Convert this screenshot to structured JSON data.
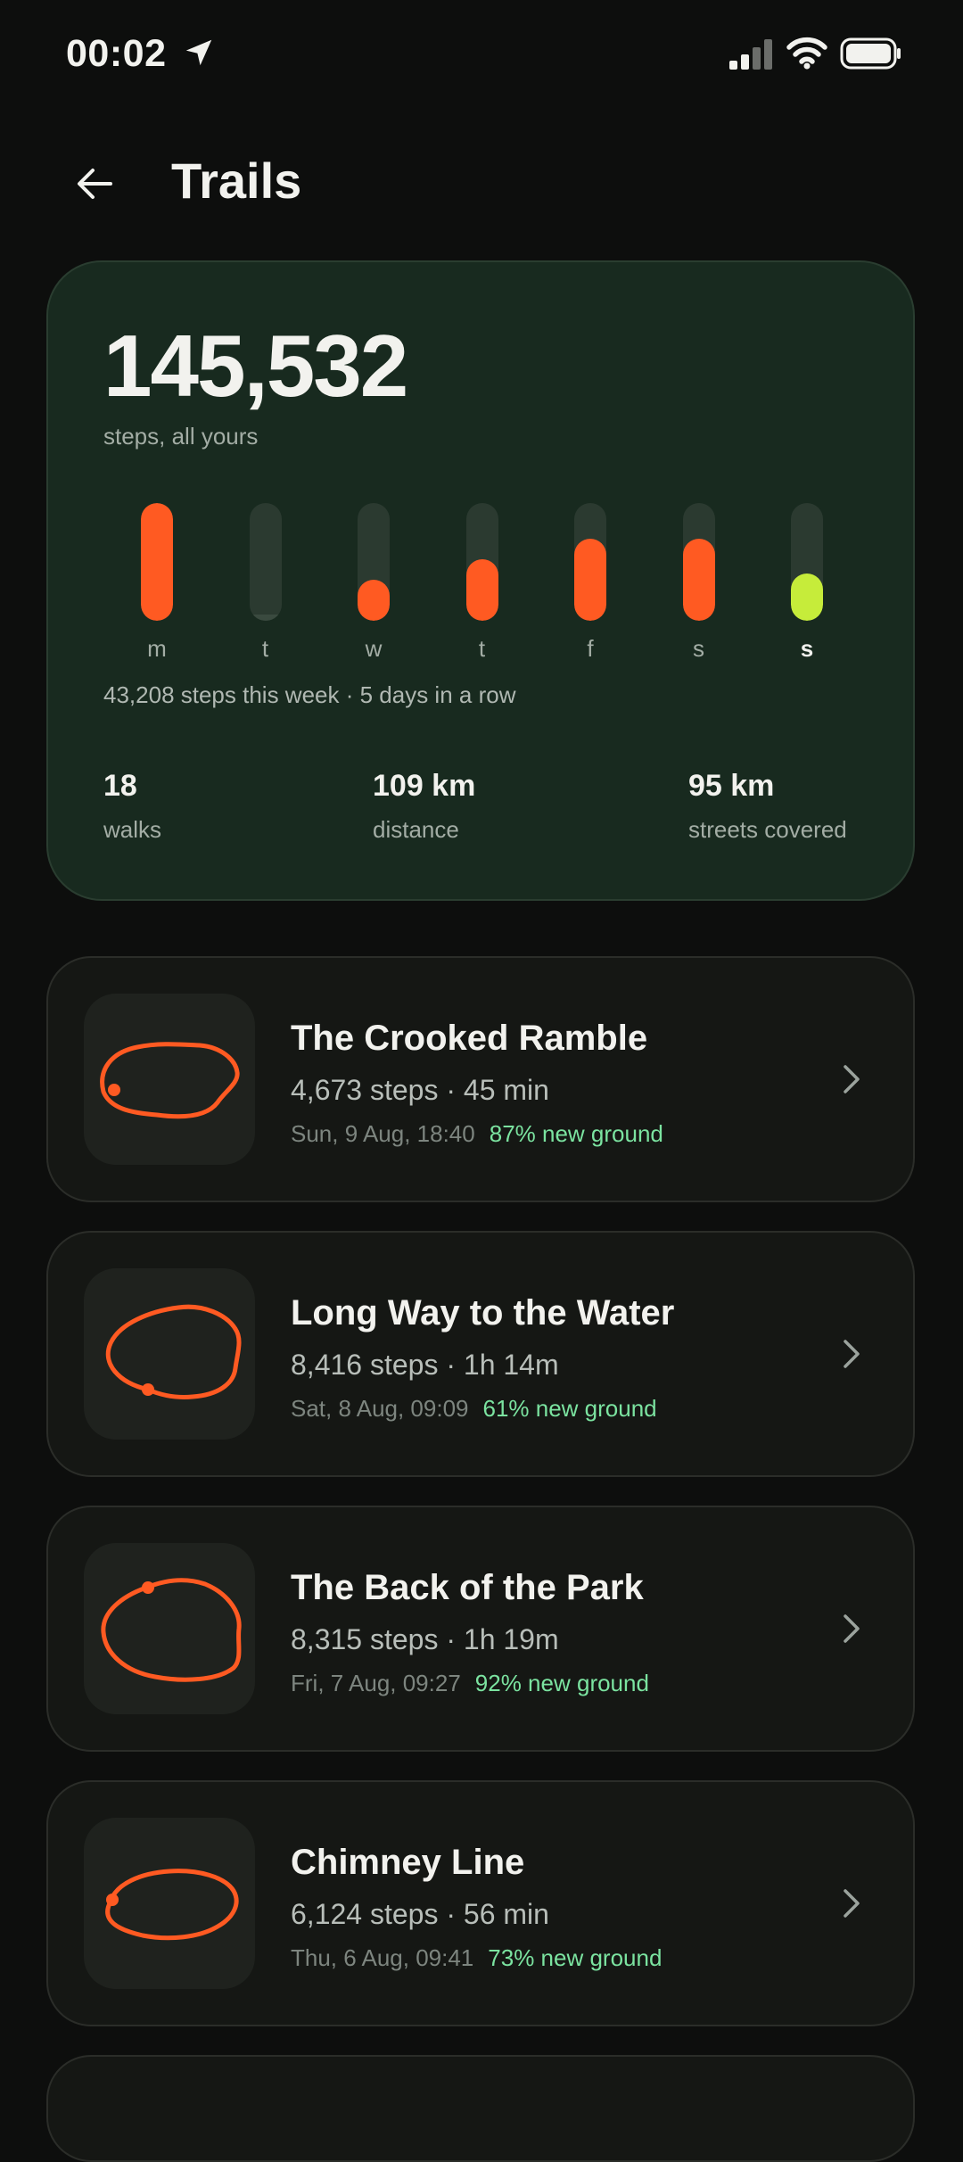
{
  "status_bar": {
    "time": "00:02"
  },
  "header": {
    "title": "Trails"
  },
  "summary": {
    "total_steps": "145,532",
    "caption": "steps, all yours",
    "week_summary": "43,208 steps this week · 5 days in a row",
    "stats": [
      {
        "value": "18",
        "label": "walks"
      },
      {
        "value": "109 km",
        "label": "distance"
      },
      {
        "value": "95 km",
        "label": "streets covered"
      }
    ]
  },
  "chart_data": {
    "type": "bar",
    "categories": [
      "m",
      "t",
      "w",
      "t",
      "f",
      "s",
      "s"
    ],
    "values": [
      1.0,
      0.05,
      0.35,
      0.52,
      0.7,
      0.7,
      0.4
    ],
    "ylim": [
      0,
      1
    ],
    "highlight_index": 6,
    "bar_color": "#ff5a22",
    "highlight_color": "#c6ec3a",
    "track_color": "#2b3a30"
  },
  "walks": [
    {
      "title": "The Crooked Ramble",
      "meta": "4,673 steps · 45 min",
      "date": "Sun, 9 Aug, 18:40",
      "new_ground": "87% new ground"
    },
    {
      "title": "Long Way to the Water",
      "meta": "8,416 steps · 1h 14m",
      "date": "Sat, 8 Aug, 09:09",
      "new_ground": "61% new ground"
    },
    {
      "title": "The Back of the Park",
      "meta": "8,315 steps · 1h 19m",
      "date": "Fri, 7 Aug, 09:27",
      "new_ground": "92% new ground"
    },
    {
      "title": "Chimney Line",
      "meta": "6,124 steps · 56 min",
      "date": "Thu, 6 Aug, 09:41",
      "new_ground": "73% new ground"
    }
  ],
  "colors": {
    "accent": "#ff5a22",
    "new_ground": "#7be3a0",
    "card_bg": "#182a1f"
  }
}
